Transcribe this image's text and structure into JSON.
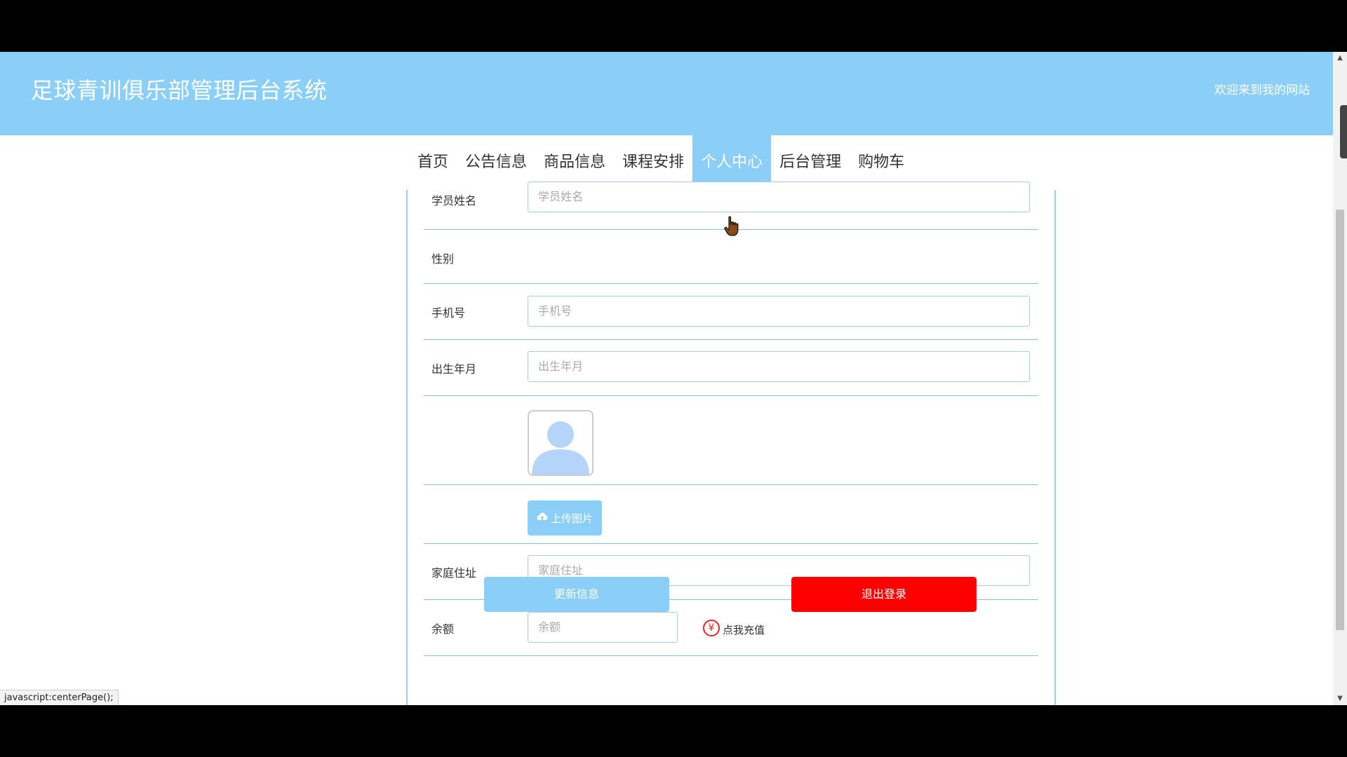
{
  "header": {
    "title": "足球青训俱乐部管理后台系统",
    "welcome": "欢迎来到我的网站"
  },
  "nav": {
    "items": [
      "首页",
      "公告信息",
      "商品信息",
      "课程安排",
      "个人中心",
      "后台管理",
      "购物车"
    ],
    "active": "个人中心"
  },
  "form": {
    "name_label": "学员姓名",
    "name_placeholder": "学员姓名",
    "gender_label": "性别",
    "phone_label": "手机号",
    "phone_placeholder": "手机号",
    "birth_label": "出生年月",
    "birth_placeholder": "出生年月",
    "avatar_icon": "user-avatar-icon",
    "upload_label": "上传图片",
    "upload_icon": "cloud-upload-icon",
    "address_label": "家庭住址",
    "address_placeholder": "家庭住址",
    "balance_label": "余额",
    "balance_placeholder": "余额",
    "recharge_icon_glyph": "¥",
    "recharge_label": "点我充值"
  },
  "buttons": {
    "update": "更新信息",
    "logout": "退出登录"
  },
  "status_bar": {
    "link": "javascript:centerPage();"
  },
  "colors": {
    "header_bg": "#8bcef8",
    "active_nav_bg": "#8bcef8",
    "update_button": "#8bcef8",
    "logout_button": "#ff0000",
    "recharge_icon": "#ee2222"
  }
}
